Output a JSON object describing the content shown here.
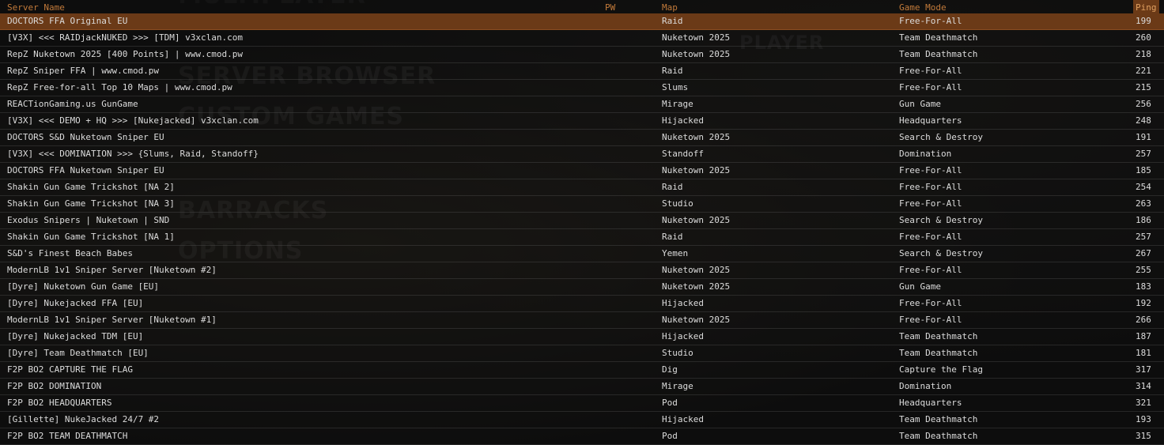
{
  "background_menu": [
    "MULTIPLAYER",
    "PLAYER",
    "SERVER BROWSER",
    "CUSTOM GAMES",
    "BARRACKS",
    "OPTIONS"
  ],
  "columns": {
    "server_name": "Server Name",
    "pw": "PW",
    "map": "Map",
    "game_mode": "Game Mode",
    "ping": "Ping"
  },
  "colors": {
    "accent": "#c27a3a",
    "selected_row": "#6b3a17"
  },
  "servers": [
    {
      "name": "DOCTORS FFA Original EU",
      "map": "Raid",
      "mode": "Free-For-All",
      "ping": "199",
      "selected": true
    },
    {
      "name": "[V3X] <<< RAIDjackNUKED >>> [TDM] v3xclan.com",
      "map": "Nuketown 2025",
      "mode": "Team Deathmatch",
      "ping": "260"
    },
    {
      "name": "RepZ  Nuketown 2025  [400 Points]  |  www.cmod.pw",
      "map": "Nuketown 2025",
      "mode": "Team Deathmatch",
      "ping": "218"
    },
    {
      "name": "RepZ Sniper FFA | www.cmod.pw",
      "map": "Raid",
      "mode": "Free-For-All",
      "ping": "221"
    },
    {
      "name": "RepZ Free-for-all Top 10 Maps |  www.cmod.pw",
      "map": "Slums",
      "mode": "Free-For-All",
      "ping": "215"
    },
    {
      "name": "REACTionGaming.us GunGame",
      "map": "Mirage",
      "mode": "Gun Game",
      "ping": "256"
    },
    {
      "name": "[V3X] <<< DEMO + HQ >>> [Nukejacked] v3xclan.com",
      "map": "Hijacked",
      "mode": "Headquarters",
      "ping": "248"
    },
    {
      "name": "DOCTORS S&D Nuketown Sniper EU",
      "map": "Nuketown 2025",
      "mode": "Search & Destroy",
      "ping": "191"
    },
    {
      "name": "[V3X] <<< DOMINATION >>> {Slums, Raid, Standoff}",
      "map": "Standoff",
      "mode": "Domination",
      "ping": "257"
    },
    {
      "name": "DOCTORS FFA Nuketown Sniper EU",
      "map": "Nuketown 2025",
      "mode": "Free-For-All",
      "ping": "185"
    },
    {
      "name": "Shakin Gun Game Trickshot [NA 2]",
      "map": "Raid",
      "mode": "Free-For-All",
      "ping": "254"
    },
    {
      "name": "Shakin Gun Game Trickshot [NA 3]",
      "map": "Studio",
      "mode": "Free-For-All",
      "ping": "263"
    },
    {
      "name": "Exodus Snipers | Nuketown | SND",
      "map": "Nuketown 2025",
      "mode": "Search & Destroy",
      "ping": "186"
    },
    {
      "name": "Shakin Gun Game Trickshot [NA 1]",
      "map": "Raid",
      "mode": "Free-For-All",
      "ping": "257"
    },
    {
      "name": "S&D's Finest Beach Babes",
      "map": "Yemen",
      "mode": "Search & Destroy",
      "ping": "267"
    },
    {
      "name": "ModernLB 1v1 Sniper Server [Nuketown #2]",
      "map": "Nuketown 2025",
      "mode": "Free-For-All",
      "ping": "255"
    },
    {
      "name": "[Dyre] Nuketown Gun Game [EU]",
      "map": "Nuketown 2025",
      "mode": "Gun Game",
      "ping": "183"
    },
    {
      "name": "[Dyre] Nukejacked FFA [EU]",
      "map": "Hijacked",
      "mode": "Free-For-All",
      "ping": "192"
    },
    {
      "name": "ModernLB 1v1 Sniper Server [Nuketown #1]",
      "map": "Nuketown 2025",
      "mode": "Free-For-All",
      "ping": "266"
    },
    {
      "name": "[Dyre] Nukejacked TDM [EU]",
      "map": "Hijacked",
      "mode": "Team Deathmatch",
      "ping": "187"
    },
    {
      "name": "[Dyre] Team Deathmatch [EU]",
      "map": "Studio",
      "mode": "Team Deathmatch",
      "ping": "181"
    },
    {
      "name": "F2P BO2 CAPTURE THE FLAG",
      "map": "Dig",
      "mode": "Capture the Flag",
      "ping": "317"
    },
    {
      "name": "F2P BO2 DOMINATION",
      "map": "Mirage",
      "mode": "Domination",
      "ping": "314"
    },
    {
      "name": "F2P BO2 HEADQUARTERS",
      "map": "Pod",
      "mode": "Headquarters",
      "ping": "321"
    },
    {
      "name": "[Gillette] NukeJacked 24/7 #2",
      "map": "Hijacked",
      "mode": "Team Deathmatch",
      "ping": "193"
    },
    {
      "name": "F2P BO2 TEAM DEATHMATCH",
      "map": "Pod",
      "mode": "Team Deathmatch",
      "ping": "315"
    }
  ]
}
